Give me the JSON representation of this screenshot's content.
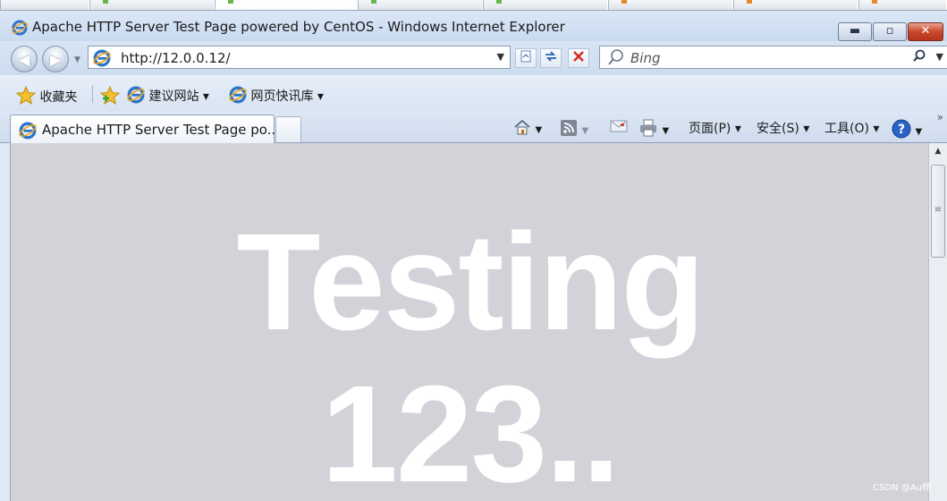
{
  "window": {
    "title": "Apache HTTP Server Test Page powered by CentOS - Windows Internet Explorer",
    "minimize_glyph": "▬",
    "maximize_glyph": "▫",
    "close_glyph": "✕"
  },
  "address_bar": {
    "url": "http://12.0.0.12/",
    "search_placeholder": "Bing"
  },
  "favorites_bar": {
    "favorites_label": "收藏夹",
    "suggested_sites": "建议网站 ▾",
    "web_slice_gallery": "网页快讯库 ▾"
  },
  "tabs": [
    {
      "title": "Apache HTTP Server Test Page po..."
    }
  ],
  "command_bar": {
    "page_menu": "页面(P) ▾",
    "safety_menu": "安全(S) ▾",
    "tools_menu": "工具(O) ▾"
  },
  "content": {
    "line1": "Testing",
    "line2": "123.."
  },
  "watermark": "CSDN @Au杨",
  "colors": {
    "content_bg": "#d3d2d9",
    "chrome_bg": "#d8e5f5",
    "close_red": "#c9482b"
  }
}
